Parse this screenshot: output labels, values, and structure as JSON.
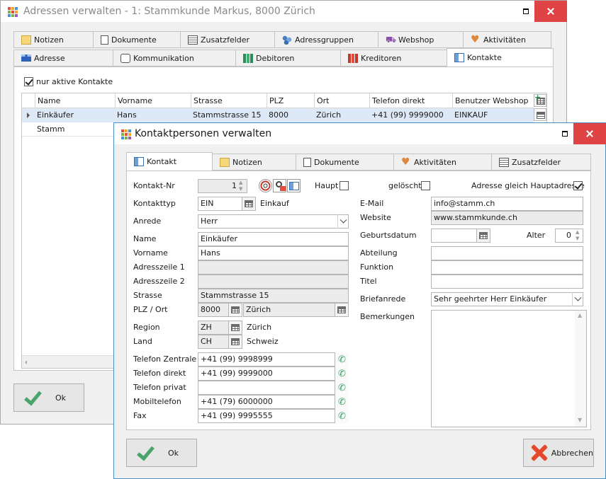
{
  "main_window": {
    "title": "Adressen verwalten - 1: Stammkunde Markus, 8000 Zürich",
    "tabs_row1": [
      "Notizen",
      "Dokumente",
      "Zusatzfelder",
      "Adressgruppen",
      "Webshop",
      "Aktivitäten"
    ],
    "tabs_row2": [
      "Adresse",
      "Kommunikation",
      "Debitoren",
      "Kreditoren",
      "Kontakte"
    ],
    "active_tab": "Kontakte",
    "only_active_label": "nur aktive Kontakte",
    "only_active_checked": true,
    "grid": {
      "columns": [
        "Name",
        "Vorname",
        "Strasse",
        "PLZ",
        "Ort",
        "Telefon direkt",
        "Benutzer Webshop"
      ],
      "rows": [
        [
          "Einkäufer",
          "Hans",
          "Stammstrasse 15",
          "8000",
          "Zürich",
          "+41 (99) 9999000",
          "EINKAUF"
        ],
        [
          "Stamm",
          "",
          "",
          "",
          "",
          "",
          ""
        ]
      ]
    },
    "ok_label": "Ok"
  },
  "dialog": {
    "title": "Kontaktpersonen verwalten",
    "tabs": [
      "Kontakt",
      "Notizen",
      "Dokumente",
      "Aktivitäten",
      "Zusatzfelder"
    ],
    "active_tab": "Kontakt",
    "labels": {
      "kontakt_nr": "Kontakt-Nr",
      "haupt": "Haupt",
      "geloescht": "gelöscht",
      "adresse_gleich": "Adresse gleich Hauptadresse",
      "kontakttyp": "Kontakttyp",
      "anrede": "Anrede",
      "name": "Name",
      "vorname": "Vorname",
      "adresszeile1": "Adresszeile 1",
      "adresszeile2": "Adresszeile 2",
      "strasse": "Strasse",
      "plz_ort": "PLZ / Ort",
      "region": "Region",
      "land": "Land",
      "telefon_zentrale": "Telefon Zentrale",
      "telefon_direkt": "Telefon direkt",
      "telefon_privat": "Telefon privat",
      "mobiltelefon": "Mobiltelefon",
      "fax": "Fax",
      "email": "E-Mail",
      "website": "Website",
      "geburtsdatum": "Geburtsdatum",
      "alter": "Alter",
      "abteilung": "Abteilung",
      "funktion": "Funktion",
      "titel": "Titel",
      "briefanrede": "Briefanrede",
      "bemerkungen": "Bemerkungen"
    },
    "values": {
      "kontakt_nr": "1",
      "haupt": false,
      "geloescht": false,
      "adresse_gleich": true,
      "kontakttyp": "EIN",
      "kontakttyp_text": "Einkauf",
      "anrede": "Herr",
      "name": "Einkäufer",
      "vorname": "Hans",
      "adresszeile1": "",
      "adresszeile2": "",
      "strasse": "Stammstrasse 15",
      "plz": "8000",
      "ort": "Zürich",
      "region": "ZH",
      "region_text": "Zürich",
      "land": "CH",
      "land_text": "Schweiz",
      "telefon_zentrale": "+41 (99) 9998999",
      "telefon_direkt": "+41 (99) 9999000",
      "telefon_privat": "",
      "mobiltelefon": "+41 (79) 6000000",
      "fax": "+41 (99) 9995555",
      "email": "info@stamm.ch",
      "website": "www.stammkunde.ch",
      "geburtsdatum": "",
      "alter": "0",
      "abteilung": "",
      "funktion": "",
      "titel": "",
      "briefanrede": "Sehr geehrter Herr Einkäufer",
      "bemerkungen": ""
    },
    "ok_label": "Ok",
    "cancel_label": "Abbrechen"
  }
}
